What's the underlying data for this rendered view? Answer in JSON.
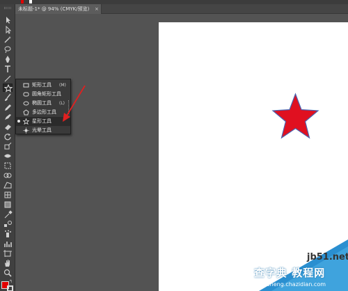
{
  "window": {
    "doc_tab_title": "未标题-1* @ 94% (CMYK/预览)",
    "doc_tab_close": "×"
  },
  "toolbar": {
    "tools": [
      "selection",
      "direct-selection",
      "magic-wand",
      "lasso",
      "pen",
      "type",
      "line",
      "star",
      "paintbrush",
      "pencil",
      "blob-brush",
      "eraser",
      "rotate",
      "scale",
      "width",
      "free-transform",
      "shape-builder",
      "perspective-grid",
      "mesh",
      "gradient",
      "eyedropper",
      "blend",
      "symbol-sprayer",
      "column-graph",
      "artboard",
      "slice",
      "hand",
      "zoom"
    ],
    "fill_color": "#e00000",
    "stroke_color": "#ffffff"
  },
  "flyout": {
    "items": [
      {
        "label": "矩形工具",
        "key": "(M)",
        "icon": "rectangle-icon"
      },
      {
        "label": "圆角矩形工具",
        "key": "",
        "icon": "rounded-rectangle-icon"
      },
      {
        "label": "椭圆工具",
        "key": "(L)",
        "icon": "ellipse-icon"
      },
      {
        "label": "多边形工具",
        "key": "",
        "icon": "polygon-icon"
      },
      {
        "label": "星形工具",
        "key": "",
        "icon": "star-icon",
        "selected": true
      },
      {
        "label": "光晕工具",
        "key": "",
        "icon": "flare-icon"
      }
    ]
  },
  "canvas": {
    "star_fill": "#e01020",
    "star_stroke": "#4a63b0",
    "arrow_color": "#e02020"
  },
  "watermark": {
    "site": "jb51.net",
    "title": "查字典 教程网",
    "url": "jiaocheng.chazidian.com"
  }
}
